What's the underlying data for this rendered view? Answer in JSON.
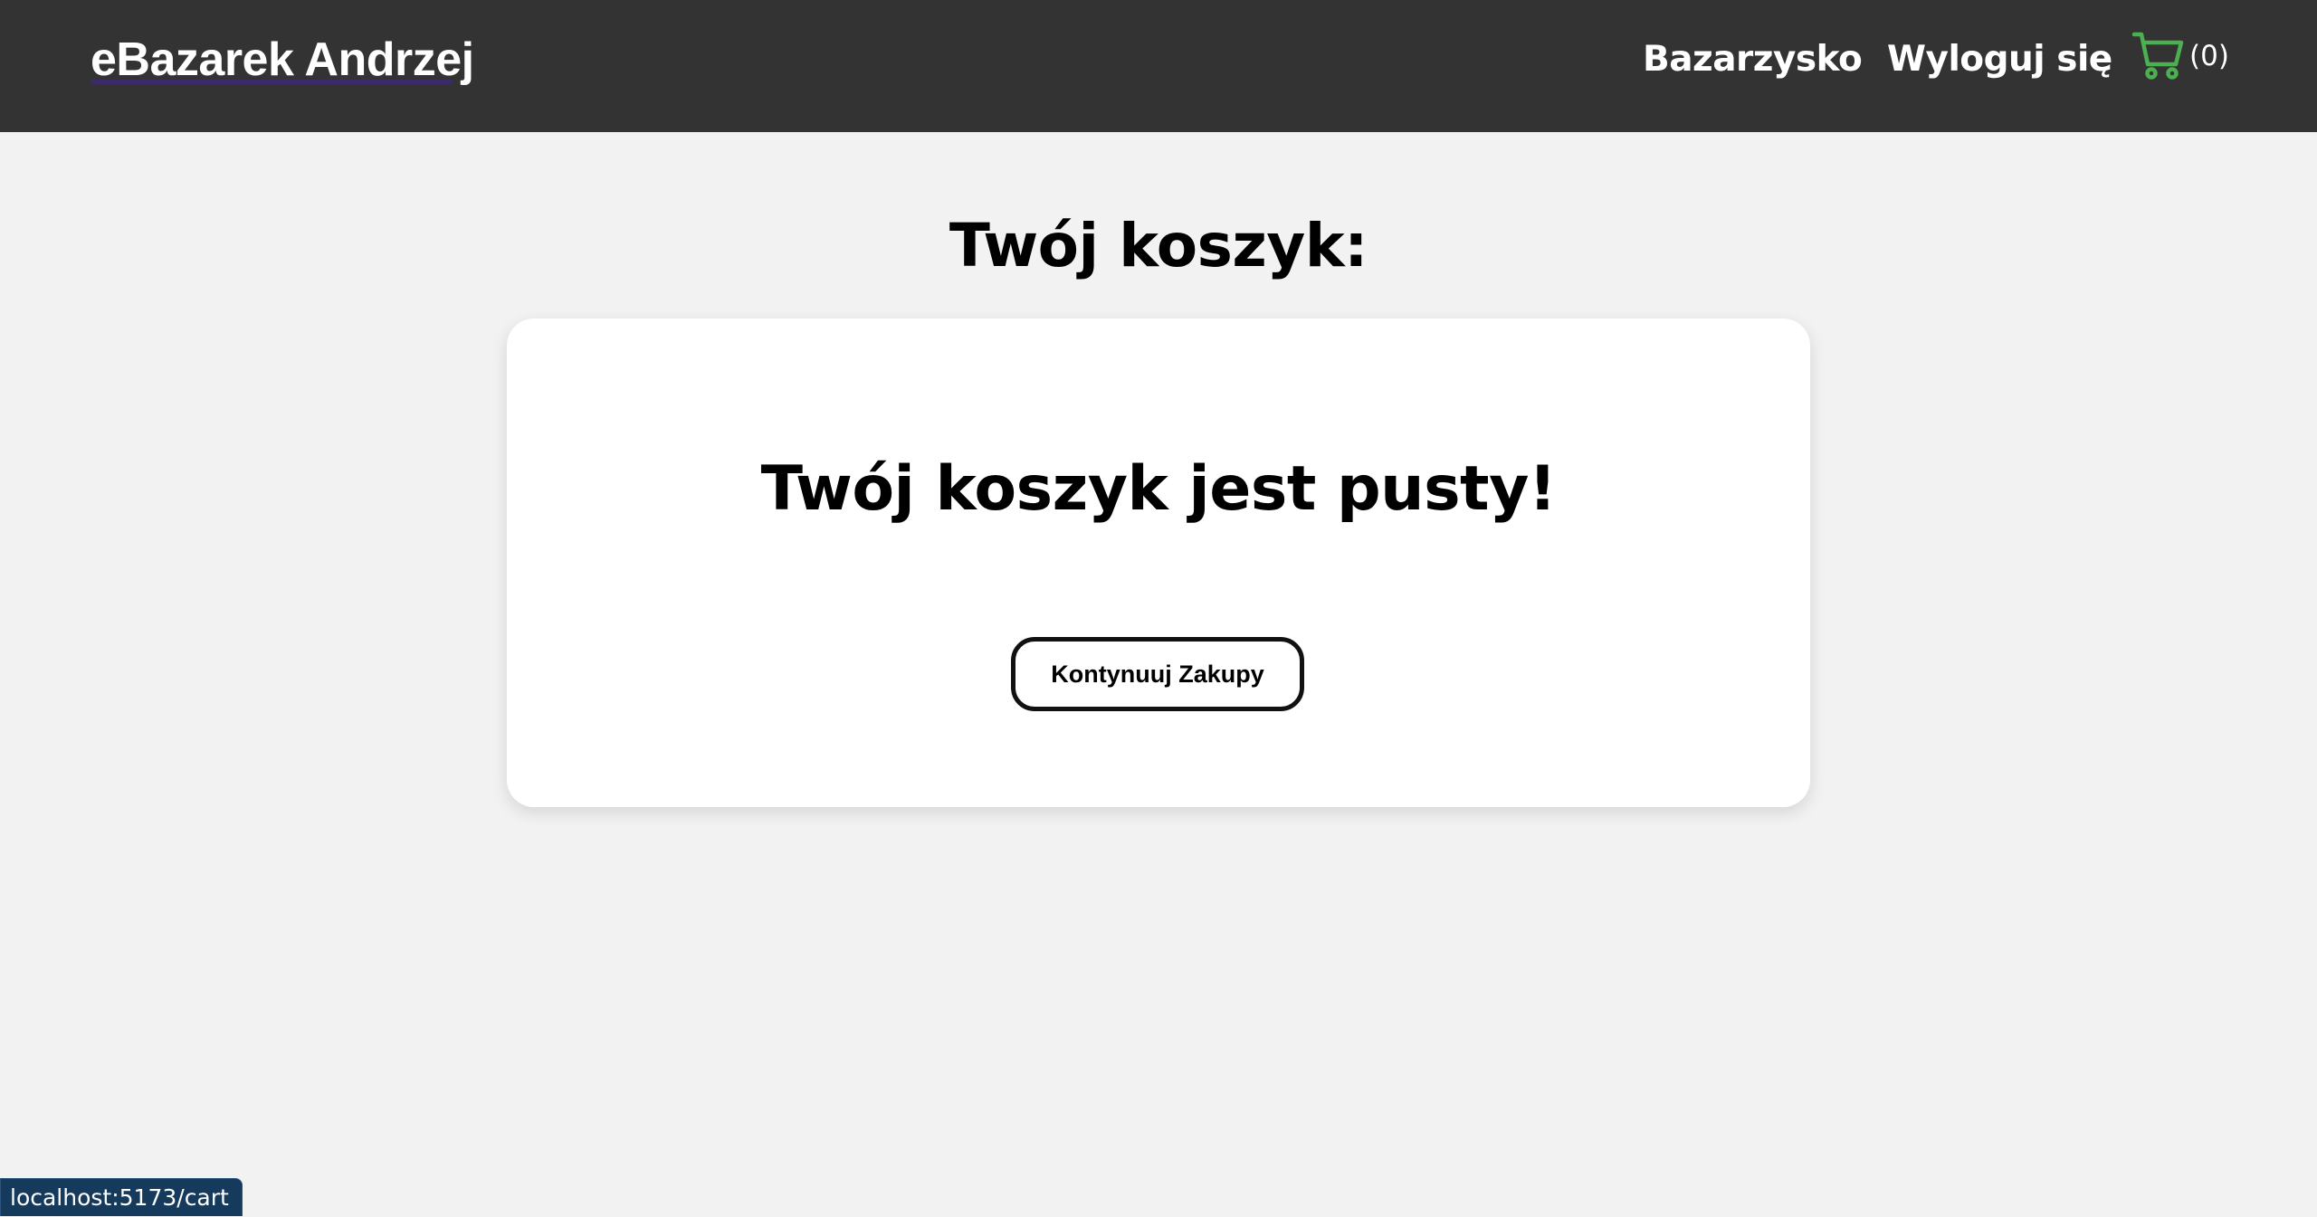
{
  "header": {
    "brand": "eBazarek Andrzej",
    "nav": {
      "shop_label": "Bazarzysko",
      "logout_label": "Wyloguj się"
    },
    "cart": {
      "icon": "cart-icon",
      "count_label": "(0)",
      "icon_color": "#4caf50"
    }
  },
  "main": {
    "title": "Twój koszyk:",
    "empty_message": "Twój koszyk jest pusty!",
    "continue_button_label": "Kontynuuj Zakupy"
  },
  "status_bar": {
    "url": "localhost:5173/cart"
  },
  "colors": {
    "navbar_bg": "#333333",
    "page_bg": "#f2f2f2",
    "card_bg": "#ffffff",
    "status_bg": "#163a5c"
  }
}
